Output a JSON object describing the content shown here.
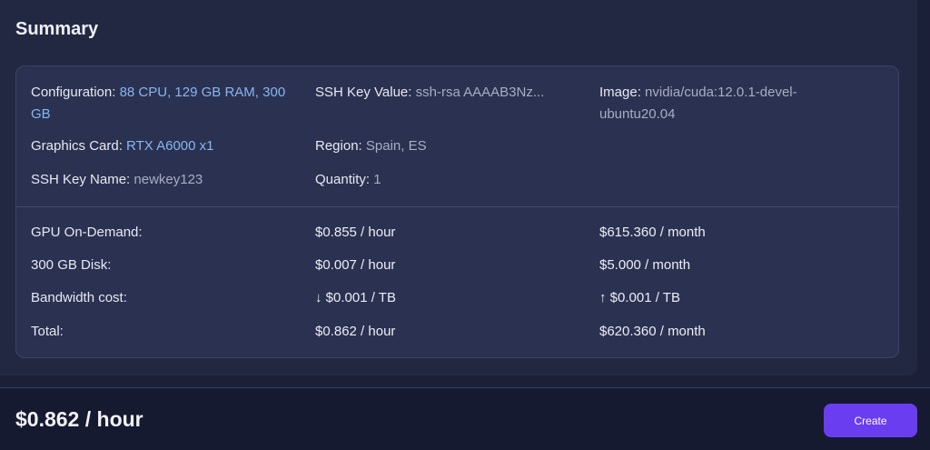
{
  "summary": {
    "title": "Summary",
    "configuration": {
      "label": "Configuration:",
      "value": "88 CPU, 129 GB RAM, 300 GB"
    },
    "ssh_key_value": {
      "label": "SSH Key Value:",
      "value": "ssh-rsa AAAAB3Nz..."
    },
    "image": {
      "label": "Image:",
      "value": "nvidia/cuda:12.0.1-devel-ubuntu20.04"
    },
    "graphics_card": {
      "label": "Graphics Card:",
      "value": "RTX A6000 x1"
    },
    "region": {
      "label": "Region:",
      "value": "Spain, ES"
    },
    "ssh_key_name": {
      "label": "SSH Key Name:",
      "value": "newkey123"
    },
    "quantity": {
      "label": "Quantity:",
      "value": "1"
    }
  },
  "costs": [
    {
      "label": "GPU On-Demand:",
      "hourly": "$0.855 / hour",
      "monthly": "$615.360 / month"
    },
    {
      "label": "300 GB Disk:",
      "hourly": "$0.007 / hour",
      "monthly": "$5.000 / month"
    },
    {
      "label": "Bandwidth cost:",
      "hourly": "↓ $0.001 / TB",
      "monthly": "↑ $0.001 / TB"
    },
    {
      "label": "Total:",
      "hourly": "$0.862 / hour",
      "monthly": "$620.360 / month"
    }
  ],
  "footer": {
    "total_price": "$0.862 / hour",
    "create_label": "Create"
  },
  "colors": {
    "accent": "#6a3df0",
    "link": "#86b6f0"
  }
}
